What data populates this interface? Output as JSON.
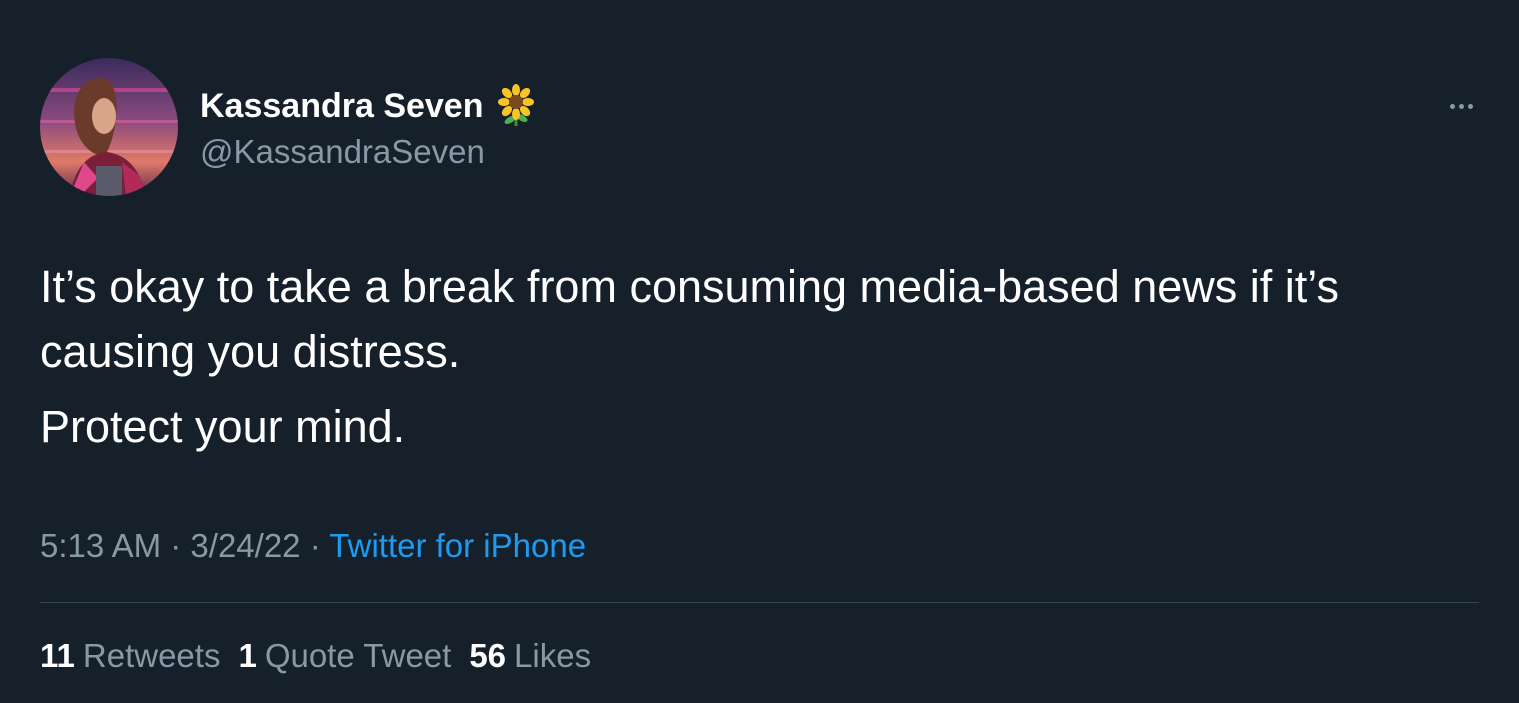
{
  "author": {
    "name": "Kassandra Seven",
    "handle": "@KassandraSeven",
    "name_emoji_icon": "sunflower-icon"
  },
  "tweet": {
    "paragraphs": [
      "It’s okay to take a break from consuming media-based news if it’s causing you distress.",
      "Protect your mind."
    ]
  },
  "meta": {
    "time": "5:13 AM",
    "separator": "·",
    "date": "3/24/22",
    "source": "Twitter for iPhone"
  },
  "stats": {
    "retweets_count": "11",
    "retweets_label": "Retweets",
    "quotes_count": "1",
    "quotes_label": "Quote Tweet",
    "likes_count": "56",
    "likes_label": "Likes"
  },
  "colors": {
    "background": "#15202b",
    "secondary_text": "#8899a6",
    "link": "#1d9bf0",
    "divider": "#38444d"
  }
}
